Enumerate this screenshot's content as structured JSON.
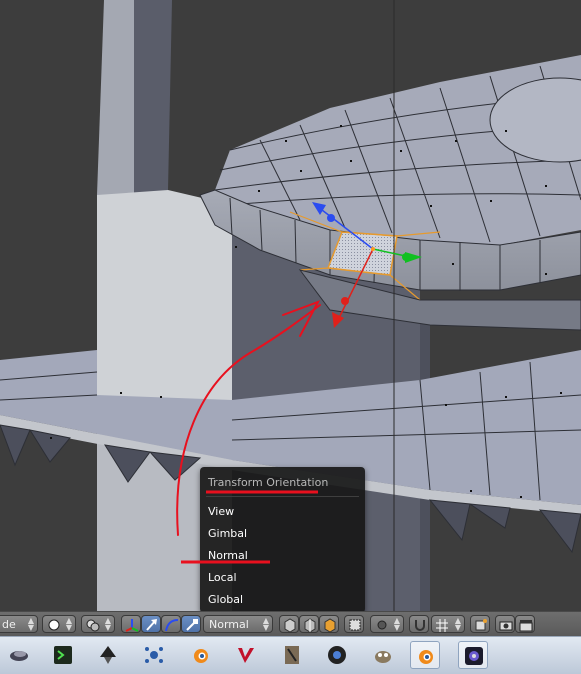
{
  "popup_menu": {
    "title": "Transform Orientation",
    "items": [
      "View",
      "Gimbal",
      "Normal",
      "Local",
      "Global"
    ],
    "highlighted_item": "Normal"
  },
  "header": {
    "mode_label": "de",
    "orientation_value": "Normal"
  },
  "annotation": {
    "color": "#e8101e"
  },
  "taskbar": {
    "icons": [
      "app-icon-1",
      "terminal-icon",
      "inkscape-icon",
      "network-icon",
      "blender-icon",
      "vim-icon",
      "pen-icon",
      "chrome-icon",
      "gimp-icon",
      "blender-icon-active",
      "app-icon-active"
    ]
  }
}
